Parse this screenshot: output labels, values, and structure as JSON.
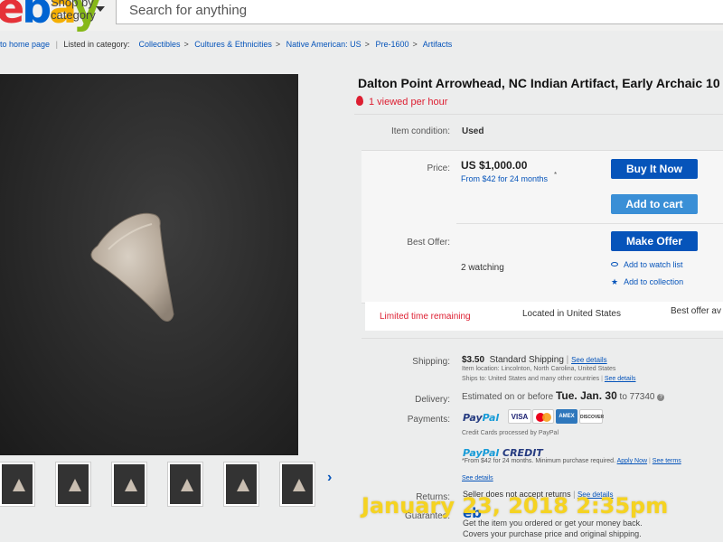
{
  "header": {
    "shop_by": "Shop by",
    "category": "category",
    "search_placeholder": "Search for anything"
  },
  "breadcrumb": {
    "back": "to home page",
    "listed_in": "Listed in category:",
    "path": [
      "Collectibles",
      "Cultures & Ethnicities",
      "Native American: US",
      "Pre-1600",
      "Artifacts"
    ]
  },
  "item": {
    "title": "Dalton Point Arrowhead, NC Indian Artifact, Early Archaic 10",
    "viewed": "1 viewed per hour",
    "condition_label": "Item condition:",
    "condition": "Used",
    "price_label": "Price:",
    "price": "US $1,000.00",
    "finance": "From $42 for 24 months",
    "finance_mark": "*",
    "best_offer_label": "Best Offer:",
    "watching": "2 watching"
  },
  "actions": {
    "buy_now": "Buy It Now",
    "add_to_cart": "Add to cart",
    "make_offer": "Make Offer",
    "watch_list": "Add to watch list",
    "collection": "Add to collection"
  },
  "status": {
    "limited": "Limited time remaining",
    "located": "Located in United States",
    "best_offer_available": "Best offer av"
  },
  "shipping": {
    "label": "Shipping:",
    "cost": "$3.50",
    "method": "Standard Shipping",
    "see_details": "See details",
    "location": "Item location:  Lincolnton, North Carolina, United States",
    "ships_to": "Ships to:  United States and many other countries",
    "ships_to_link": "See details"
  },
  "delivery": {
    "label": "Delivery:",
    "prefix": "Estimated on or before",
    "date": "Tue. Jan. 30",
    "to": "to 77340",
    "info": "?"
  },
  "payments": {
    "label": "Payments:",
    "paypal_a": "Pay",
    "paypal_b": "Pal",
    "cards": [
      "VISA",
      "MC",
      "AMEX",
      "DISCOVER"
    ],
    "processed": "Credit Cards processed by PayPal",
    "credit_a": "PayPal",
    "credit_b": "CREDIT",
    "credit_terms": "*From $42 for 24 months. Minimum purchase required.",
    "apply_now": "Apply Now",
    "see_terms": "See terms",
    "see_details": "See details"
  },
  "returns": {
    "label": "Returns:",
    "text": "Seller does not accept returns",
    "link": "See details"
  },
  "guarantee": {
    "label": "Guarantee:",
    "logo": "eb",
    "line1": "Get the item you ordered or get your money back.",
    "line2": "Covers your purchase price and original shipping."
  },
  "overlay": {
    "timestamp": "January 23, 2018 2:35pm"
  },
  "colors": {
    "ebay_blue": "#0654ba",
    "alert_red": "#dd1e31",
    "stamp_yellow": "#f5d321"
  }
}
